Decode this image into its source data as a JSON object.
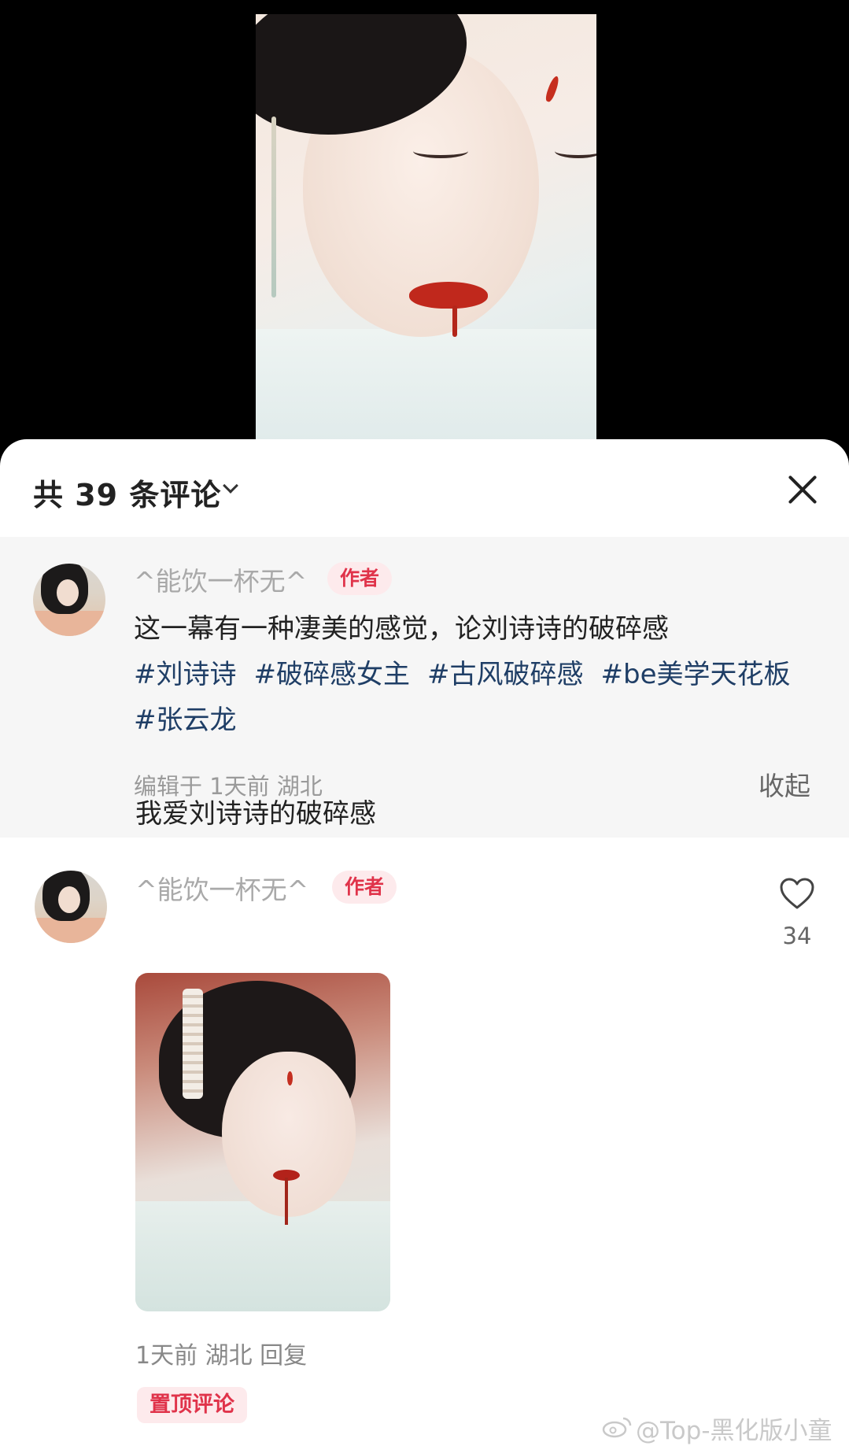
{
  "header": {
    "comment_count": "共 39 条评论"
  },
  "post": {
    "username": "^能饮一杯无^",
    "badge": "作者",
    "text": "这一幕有一种凄美的感觉，论刘诗诗的破碎感",
    "hashtags": [
      "#刘诗诗",
      "#破碎感女主",
      "#古风破碎感",
      "#be美学天花板",
      "#张云龙"
    ],
    "meta": "编辑于  1天前  湖北",
    "collapse_label": "收起"
  },
  "comment": {
    "username": "^能饮一杯无^",
    "badge": "作者",
    "text": "我爱刘诗诗的破碎感",
    "like_count": "34",
    "meta": "1天前  湖北  回复",
    "pinned_label": "置顶评论"
  },
  "watermark": "@Top-黑化版小童鞋",
  "colors": {
    "accent_red": "#e0334a",
    "hashtag_blue": "#1f3e66",
    "badge_bg": "#fdeaec"
  }
}
